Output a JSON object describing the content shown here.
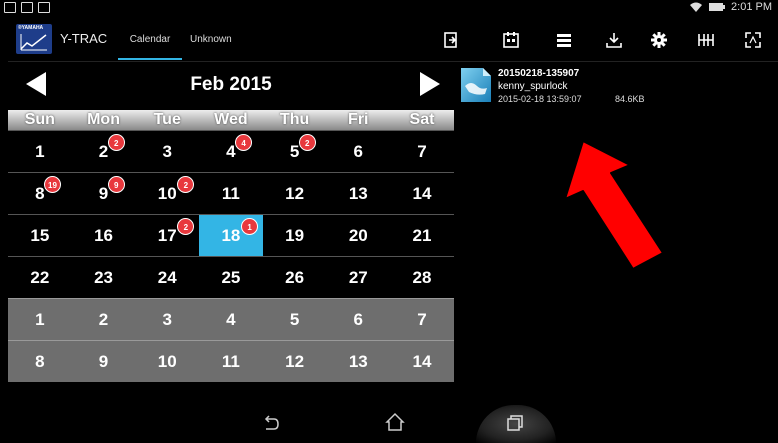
{
  "status_bar": {
    "time": "2:01 PM"
  },
  "app": {
    "brand": "®YAMAHA",
    "title": "Y-TRAC",
    "tabs": [
      {
        "label": "Calendar",
        "active": true
      },
      {
        "label": "Unknown",
        "active": false
      }
    ],
    "toolbar_icons": [
      "import-icon",
      "calendar-icon",
      "list-icon",
      "download-icon",
      "settings-gear-icon",
      "grid-icon",
      "expand-icon"
    ]
  },
  "calendar": {
    "month_label": "Feb 2015",
    "weekdays": [
      "Sun",
      "Mon",
      "Tue",
      "Wed",
      "Thu",
      "Fri",
      "Sat"
    ],
    "weeks": [
      [
        {
          "d": "1"
        },
        {
          "d": "2",
          "badge": "2"
        },
        {
          "d": "3"
        },
        {
          "d": "4",
          "badge": "4"
        },
        {
          "d": "5",
          "badge": "2"
        },
        {
          "d": "6"
        },
        {
          "d": "7"
        }
      ],
      [
        {
          "d": "8",
          "badge": "19"
        },
        {
          "d": "9",
          "badge": "9"
        },
        {
          "d": "10",
          "badge": "2"
        },
        {
          "d": "11"
        },
        {
          "d": "12"
        },
        {
          "d": "13"
        },
        {
          "d": "14"
        }
      ],
      [
        {
          "d": "15"
        },
        {
          "d": "16"
        },
        {
          "d": "17",
          "badge": "2"
        },
        {
          "d": "18",
          "badge": "1",
          "selected": true
        },
        {
          "d": "19"
        },
        {
          "d": "20"
        },
        {
          "d": "21"
        }
      ],
      [
        {
          "d": "22"
        },
        {
          "d": "23"
        },
        {
          "d": "24"
        },
        {
          "d": "25"
        },
        {
          "d": "26"
        },
        {
          "d": "27"
        },
        {
          "d": "28"
        }
      ],
      [
        {
          "d": "1"
        },
        {
          "d": "2"
        },
        {
          "d": "3"
        },
        {
          "d": "4"
        },
        {
          "d": "5"
        },
        {
          "d": "6"
        },
        {
          "d": "7"
        }
      ],
      [
        {
          "d": "8"
        },
        {
          "d": "9"
        },
        {
          "d": "10"
        },
        {
          "d": "11"
        },
        {
          "d": "12"
        },
        {
          "d": "13"
        },
        {
          "d": "14"
        }
      ]
    ],
    "selected_color": "#33b5e5",
    "badge_color": "#e8383d"
  },
  "file": {
    "name": "20150218-135907",
    "user": "kenny_spurlock",
    "datetime": "2015-02-18 13:59:07",
    "size": "84.6KB"
  },
  "annotation": {
    "arrow_color": "#ff0000"
  }
}
